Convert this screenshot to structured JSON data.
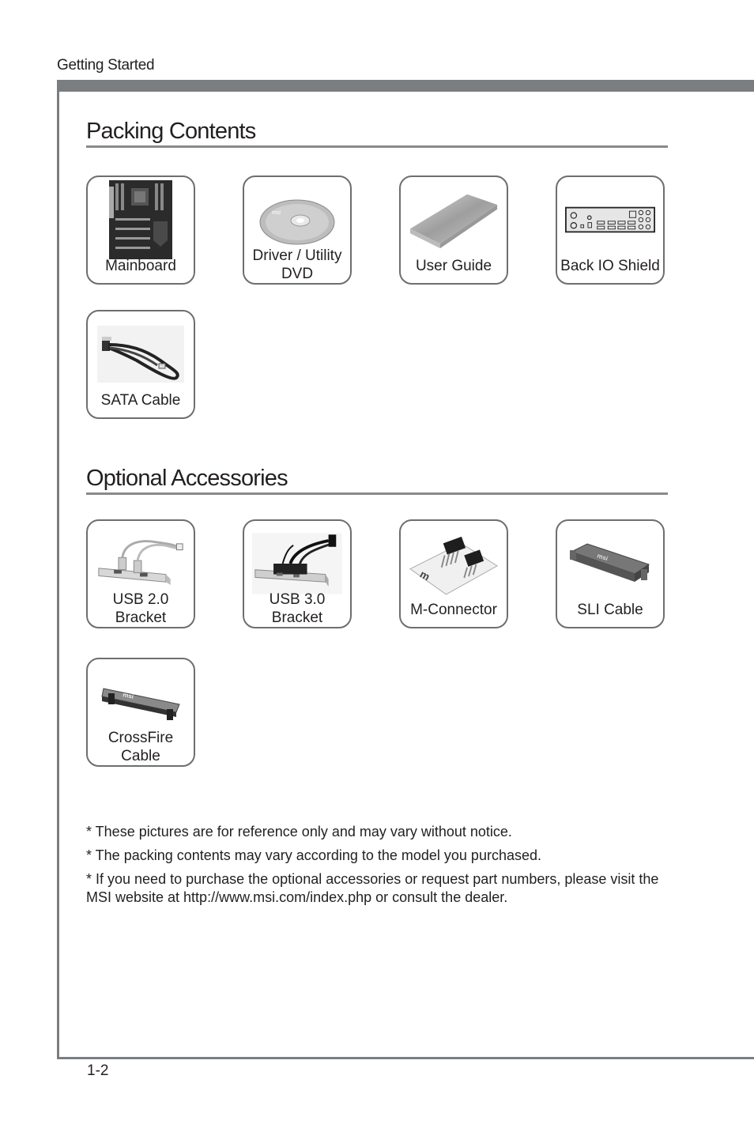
{
  "header": {
    "chapter": "Getting Started"
  },
  "packing": {
    "title": "Packing Contents",
    "items": [
      {
        "label1": "Mainboard",
        "label2": "",
        "icon": "mainboard-icon"
      },
      {
        "label1": "Driver / Utility",
        "label2": "DVD",
        "icon": "dvd-icon"
      },
      {
        "label1": "User Guide",
        "label2": "",
        "icon": "user-guide-icon"
      },
      {
        "label1": "Back IO Shield",
        "label2": "",
        "icon": "io-shield-icon"
      },
      {
        "label1": "SATA Cable",
        "label2": "",
        "icon": "sata-cable-icon"
      }
    ]
  },
  "optional": {
    "title": "Optional Accessories",
    "items": [
      {
        "label1": "USB 2.0",
        "label2": "Bracket",
        "icon": "usb2-bracket-icon"
      },
      {
        "label1": "USB 3.0",
        "label2": "Bracket",
        "icon": "usb3-bracket-icon"
      },
      {
        "label1": "M-Connector",
        "label2": "",
        "icon": "m-connector-icon"
      },
      {
        "label1": "SLI Cable",
        "label2": "",
        "icon": "sli-cable-icon"
      },
      {
        "label1": "CrossFire",
        "label2": "Cable",
        "icon": "crossfire-cable-icon"
      }
    ]
  },
  "notes": [
    "* These pictures are for reference only and may vary without notice.",
    "* The packing contents may vary according to the model you purchased.",
    "* If you need to purchase the optional accessories or request part numbers, please visit the MSI website at http://www.msi.com/index.php or consult the dealer."
  ],
  "footer": {
    "page_number": "1-2"
  }
}
